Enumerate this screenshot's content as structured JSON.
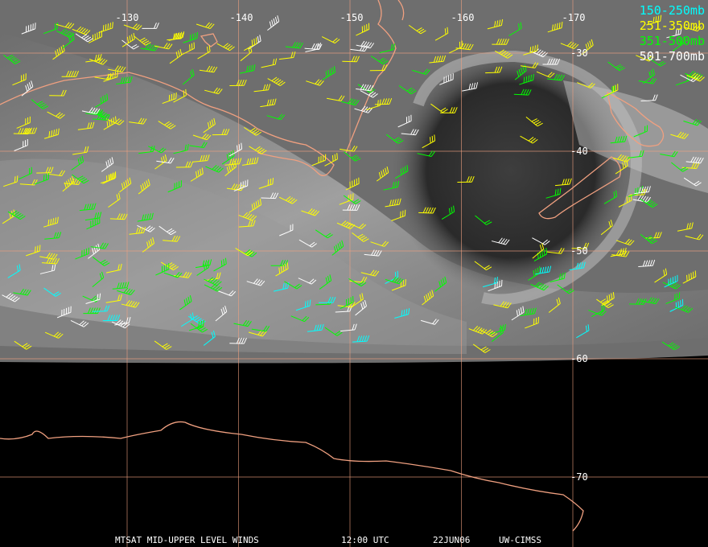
{
  "map": {
    "satellite_region_color": "#6e6e6e",
    "background_color": "#000000",
    "coastline_color": "#f0a080",
    "grid_color": "#f0a080",
    "longitude_labels": [
      "-130",
      "-140",
      "-150",
      "-160",
      "-170"
    ],
    "latitude_labels": [
      "-30",
      "-40",
      "-50",
      "-60",
      "-70"
    ]
  },
  "legend": [
    {
      "label": "150-250mb",
      "color": "#00ffff"
    },
    {
      "label": "251-350mb",
      "color": "#ffff00"
    },
    {
      "label": "351-500mb",
      "color": "#00ff00"
    },
    {
      "label": "501-700mb",
      "color": "#ffffff"
    }
  ],
  "caption": {
    "product": "MTSAT MID-UPPER LEVEL WINDS",
    "time": "12:00 UTC",
    "date": "22JUN06",
    "source": "UW-CIMSS"
  }
}
